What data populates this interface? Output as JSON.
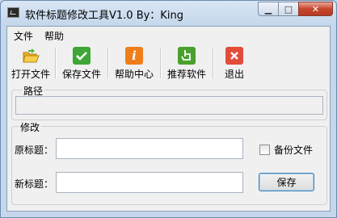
{
  "window": {
    "title": "软件标题修改工具V1.0 By：King"
  },
  "menu": {
    "file": "文件",
    "help": "帮助"
  },
  "toolbar": {
    "open": "打开文件",
    "save": "保存文件",
    "help_center": "帮助中心",
    "recommend": "推荐软件",
    "exit": "退出"
  },
  "path_group": {
    "label": "路径",
    "value": ""
  },
  "modify_group": {
    "label": "修改",
    "original_title_label": "原标题：",
    "original_title_value": "",
    "new_title_label": "新标题：",
    "new_title_value": "",
    "backup_label": "备份文件",
    "backup_checked": false,
    "save_button": "保存"
  },
  "icons": {
    "open": "folder-open-icon",
    "save": "checkmark-icon",
    "help_center": "info-icon",
    "recommend": "hand-pointer-icon",
    "exit": "close-icon"
  },
  "colors": {
    "save_icon": "#3fa535",
    "help_icon": "#ef7d1a",
    "recommend_icon": "#4aa02c",
    "exit_icon": "#e34b3a"
  }
}
